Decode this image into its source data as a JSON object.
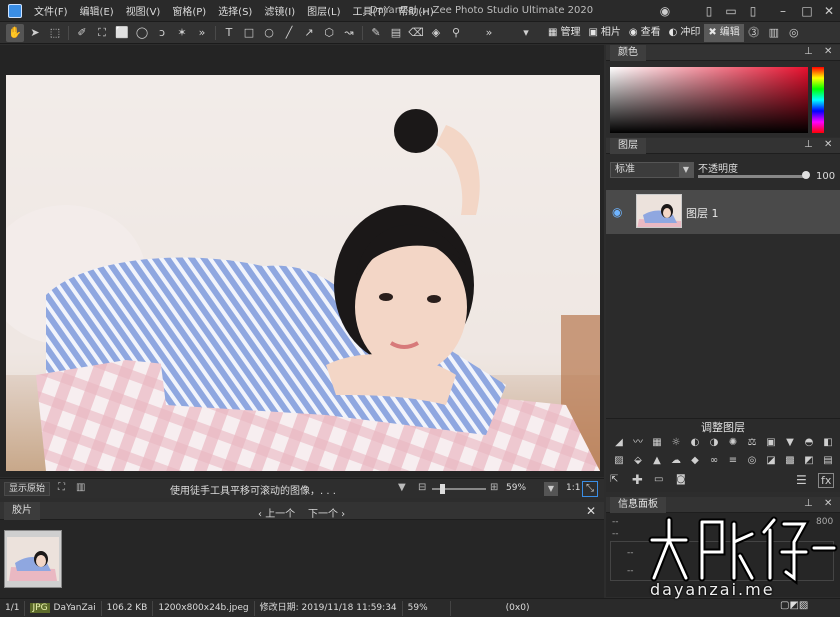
{
  "window": {
    "title": "DaYanZai ... Zee Photo Studio Ultimate 2020"
  },
  "menu": [
    "文件(F)",
    "编辑(E)",
    "视图(V)",
    "窗格(P)",
    "选择(S)",
    "滤镜(I)",
    "图层(L)",
    "工具(T)",
    "帮助(H)"
  ],
  "modes": {
    "manage": "管理",
    "photos": "相片",
    "view": "查看",
    "develop": "冲印",
    "edit": "编辑"
  },
  "canvas": {
    "show_original": "显示原始",
    "hint": "使用徒手工具平移可滚动的图像，. . .",
    "zoom": "59%",
    "ratio": "1:1"
  },
  "filmstrip": {
    "tab": "胶片",
    "prev": "上一个",
    "next": "下一个"
  },
  "color_panel": {
    "title": "颜色"
  },
  "layers_panel": {
    "title": "图层",
    "blend_mode": "标准",
    "opacity_label": "不透明度",
    "opacity_value": "100",
    "opacity_level": 1.0,
    "layer_name": "图层 1"
  },
  "adjust_panel": {
    "title": "调整图层"
  },
  "info_panel": {
    "title": "信息面板",
    "rows": [
      "--",
      "--",
      "--",
      "--"
    ],
    "right_value": "800"
  },
  "statusbar": {
    "count": "1/1",
    "format": "JPG",
    "name": "DaYanZai",
    "size": "106.2 KB",
    "dims": "1200x800x24b.jpeg",
    "modified": "修改日期: 2019/11/18 11:59:34",
    "zoom": "59%",
    "coords": "(0x0)"
  },
  "watermark": {
    "text": "dayanzai.me"
  },
  "colors": {
    "accent": "#3a8ee6",
    "panel_bg": "#2b2b2b",
    "active_mode": "#5a5a5a"
  }
}
